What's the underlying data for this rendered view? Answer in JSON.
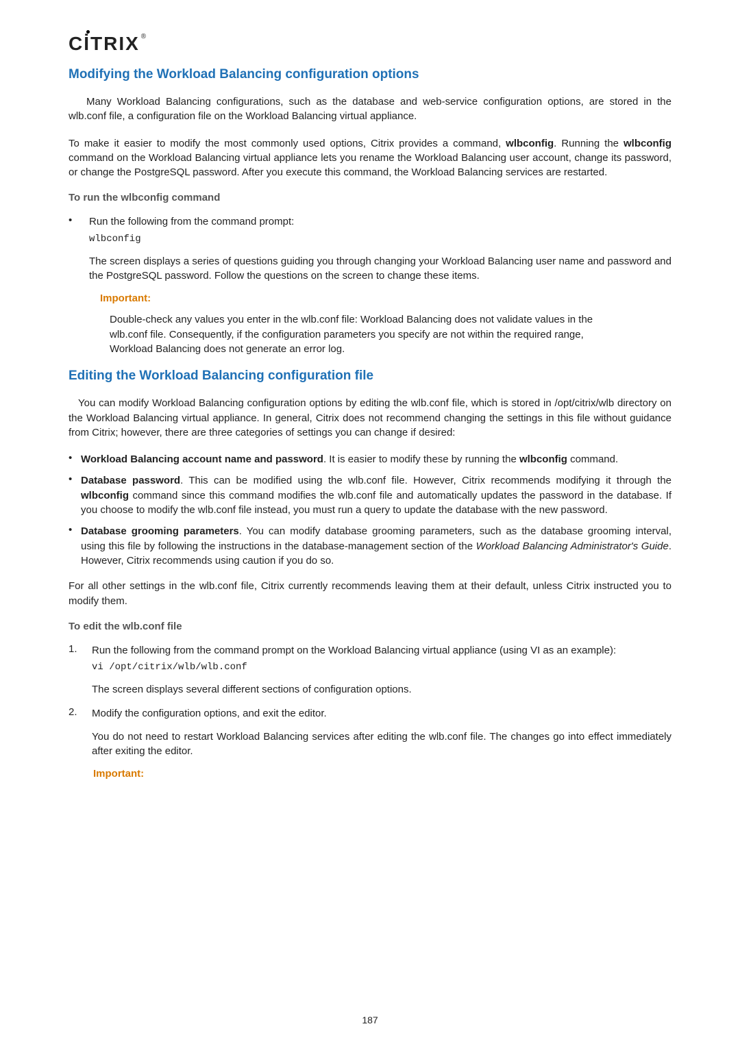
{
  "brand": {
    "name": "CİTRIX",
    "reg": "®"
  },
  "s1": {
    "heading": "Modifying the Workload Balancing configuration options",
    "p1": "Many Workload Balancing configurations, such as the database and web-service configuration options, are stored in the wlb.conf file, a configuration file on the Workload Balancing virtual appliance.",
    "p2a": "To make it easier to modify the most commonly used options, Citrix provides a command, ",
    "p2b": "wlbconfig",
    "p2c": ". Running the ",
    "p2d": "wlbconfig",
    "p2e": " command on the Workload Balancing virtual appliance lets you rename the Workload Balancing user account, change its password, or change the PostgreSQL password. After you execute this command, the Workload Balancing services are restarted.",
    "sub": "To run the wlbconfig command",
    "bullet": "Run the following from the command prompt:",
    "code": "wlbconfig",
    "after": "The screen displays a series of questions guiding you through changing your Workload Balancing user name and password and the PostgreSQL password. Follow the questions on the screen to change these items.",
    "impLabel": "Important:",
    "impText": "Double-check any values you enter in the wlb.conf file: Workload Balancing does not validate values in the wlb.conf file. Consequently, if the configuration parameters you specify are not within the required range, Workload Balancing does not generate an error log."
  },
  "s2": {
    "heading": "Editing the Workload Balancing configuration file",
    "p1": "You can modify Workload Balancing configuration options by editing the wlb.conf file, which is stored in /opt/citrix/wlb directory on the Workload Balancing virtual appliance. In general, Citrix does not recommend changing the settings in this file without guidance from Citrix; however, there are three categories of settings you can change if desired:",
    "li1a": "Workload Balancing account name and password",
    "li1b": ". It is easier to modify these by running the ",
    "li1c": "wlbconfig",
    "li1d": " command.",
    "li2a": "Database password",
    "li2b": ". This can be modified using the wlb.conf file. However, Citrix recommends modifying it through the ",
    "li2c": "wlbconfig",
    "li2d": " command since this command modifies the wlb.conf file and automatically updates the password in the database. If you choose to modify the wlb.conf file instead, you must run a query to update the database with the new password.",
    "li3a": "Database grooming parameters",
    "li3b": ". You can modify database grooming parameters, such as the database grooming interval, using this file by following the instructions in the database-management section of the ",
    "li3c": "Workload Balancing Administrator's Guide",
    "li3d": ". However, Citrix recommends using caution if you do so.",
    "p2": "For all other settings in the wlb.conf file, Citrix currently recommends leaving them at their default, unless Citrix instructed you to modify them.",
    "sub": "To edit the wlb.conf file",
    "n1": "Run the following from the command prompt on the Workload Balancing virtual appliance (using VI as an example):",
    "code": "vi /opt/citrix/wlb/wlb.conf",
    "n1after": "The screen displays several different sections of configuration options.",
    "n2": "Modify the configuration options, and exit the editor.",
    "n2after": "You do not need to restart Workload Balancing services after editing the wlb.conf file. The changes go into effect immediately after exiting the editor.",
    "impLabel": "Important:"
  },
  "pageNumber": "187"
}
